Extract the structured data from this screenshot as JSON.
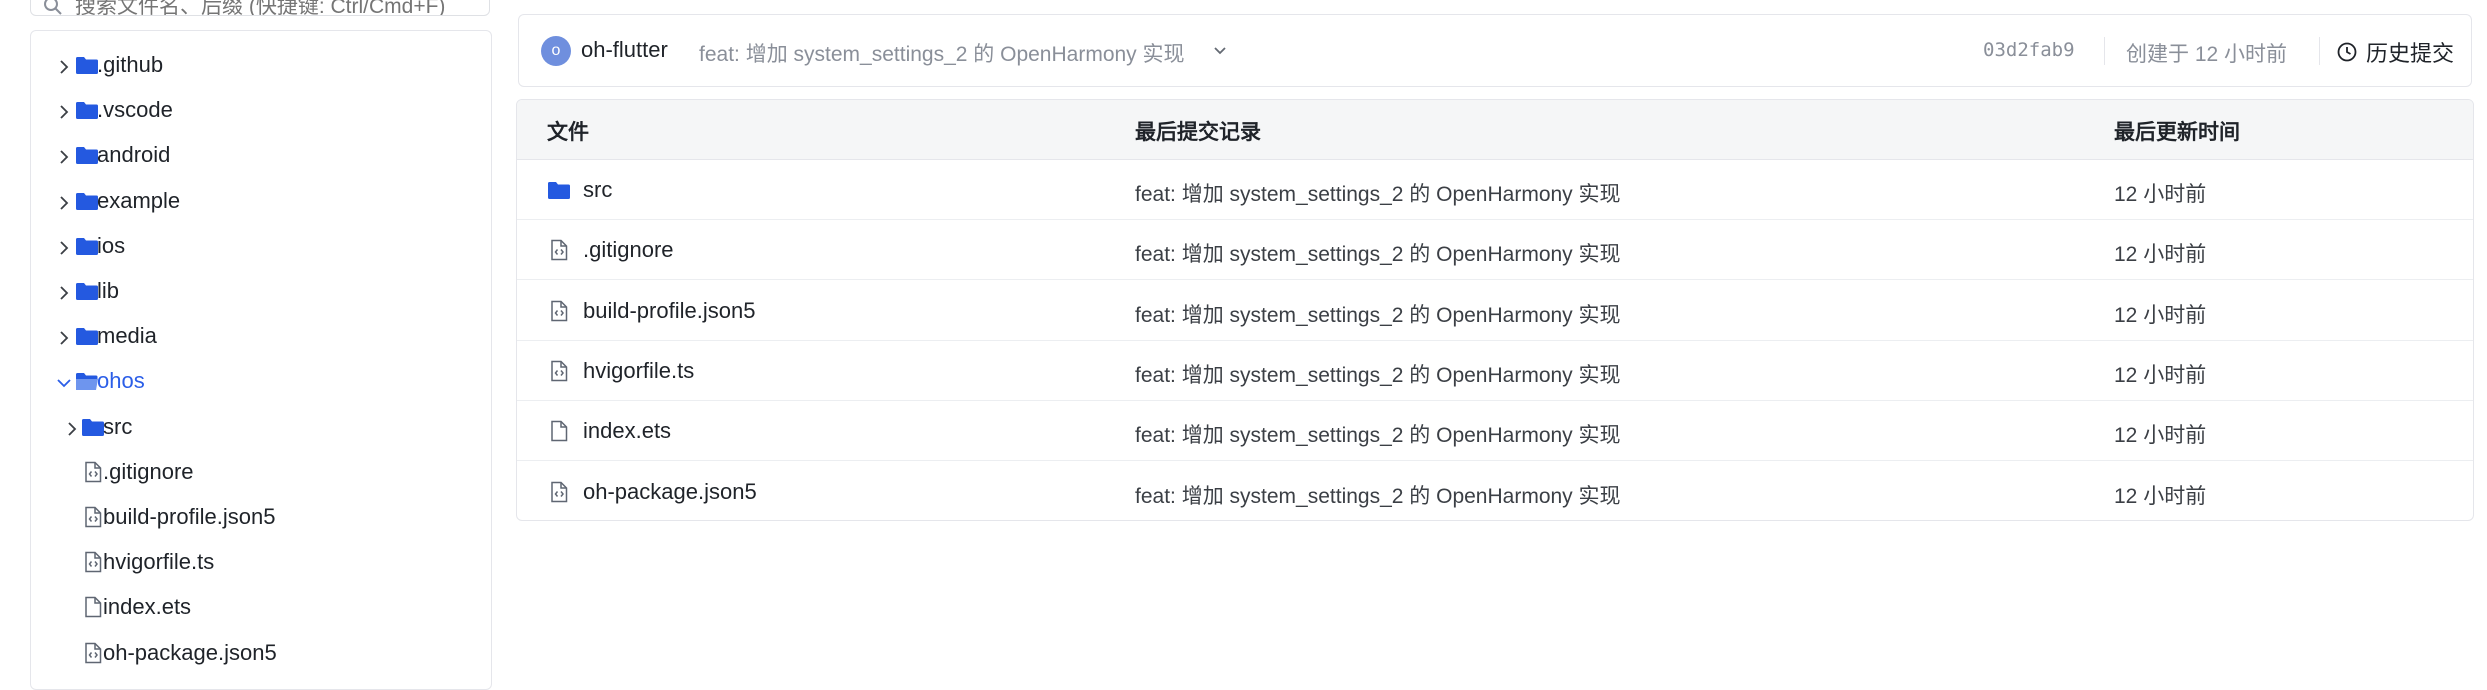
{
  "search": {
    "placeholder": "搜索文件名、后缀 (快捷键: Ctrl/Cmd+F)"
  },
  "tree": {
    "items": [
      {
        "label": ".github",
        "type": "folder",
        "expanded": false
      },
      {
        "label": ".vscode",
        "type": "folder",
        "expanded": false
      },
      {
        "label": "android",
        "type": "folder",
        "expanded": false
      },
      {
        "label": "example",
        "type": "folder",
        "expanded": false
      },
      {
        "label": "ios",
        "type": "folder",
        "expanded": false
      },
      {
        "label": "lib",
        "type": "folder",
        "expanded": false
      },
      {
        "label": "media",
        "type": "folder",
        "expanded": false
      },
      {
        "label": "ohos",
        "type": "folder",
        "expanded": true,
        "active": true
      },
      {
        "label": "src",
        "type": "folder",
        "expanded": false
      },
      {
        "label": ".gitignore",
        "type": "code-file"
      },
      {
        "label": "build-profile.json5",
        "type": "code-file"
      },
      {
        "label": "hvigorfile.ts",
        "type": "code-file"
      },
      {
        "label": "index.ets",
        "type": "file"
      },
      {
        "label": "oh-package.json5",
        "type": "code-file"
      }
    ]
  },
  "commit": {
    "avatar_letter": "o",
    "author": "oh-flutter",
    "message": "feat: 增加 system_settings_2 的 OpenHarmony 实现",
    "hash": "03d2fab9",
    "created": "创建于 12 小时前",
    "history_label": "历史提交"
  },
  "table": {
    "headers": {
      "file": "文件",
      "last_commit": "最后提交记录",
      "updated": "最后更新时间"
    },
    "rows": [
      {
        "name": "src",
        "type": "folder",
        "commit": "feat: 增加 system_settings_2 的 OpenHarmony 实现",
        "time": "12 小时前"
      },
      {
        "name": ".gitignore",
        "type": "code-file",
        "commit": "feat: 增加 system_settings_2 的 OpenHarmony 实现",
        "time": "12 小时前"
      },
      {
        "name": "build-profile.json5",
        "type": "code-file",
        "commit": "feat: 增加 system_settings_2 的 OpenHarmony 实现",
        "time": "12 小时前"
      },
      {
        "name": "hvigorfile.ts",
        "type": "code-file",
        "commit": "feat: 增加 system_settings_2 的 OpenHarmony 实现",
        "time": "12 小时前"
      },
      {
        "name": "index.ets",
        "type": "file",
        "commit": "feat: 增加 system_settings_2 的 OpenHarmony 实现",
        "time": "12 小时前"
      },
      {
        "name": "oh-package.json5",
        "type": "code-file",
        "commit": "feat: 增加 system_settings_2 的 OpenHarmony 实现",
        "time": "12 小时前"
      }
    ]
  },
  "colors": {
    "folder": "#2459e0",
    "accent": "#2b5ee8",
    "avatar": "#6f8fde"
  }
}
